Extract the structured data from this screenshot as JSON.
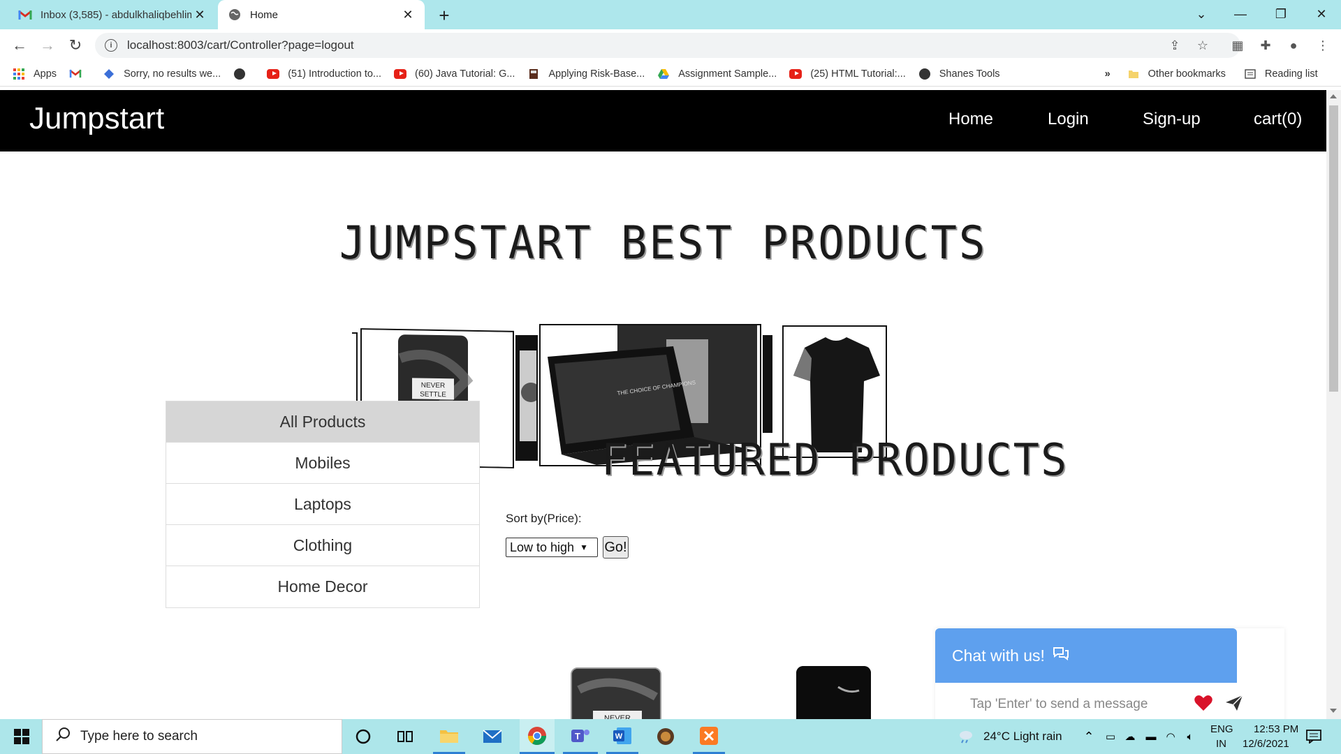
{
  "browser": {
    "tabs": [
      {
        "title": "Inbox (3,585) - abdulkhaliqbehlim",
        "active": false,
        "icon": "gmail-icon"
      },
      {
        "title": "Home",
        "active": true,
        "icon": "globe-icon"
      }
    ],
    "new_tab": "+",
    "url": "localhost:8003/cart/Controller?page=logout",
    "bookmarks": [
      {
        "label": "Apps",
        "icon": "apps-icon"
      },
      {
        "label": "",
        "icon": "gmail-icon"
      },
      {
        "label": "Sorry, no results we...",
        "icon": "diamond-icon"
      },
      {
        "label": "",
        "icon": "globe-icon"
      },
      {
        "label": "(51) Introduction to...",
        "icon": "youtube-icon"
      },
      {
        "label": "(60) Java Tutorial: G...",
        "icon": "youtube-icon"
      },
      {
        "label": "Applying Risk-Base...",
        "icon": "book-icon"
      },
      {
        "label": "Assignment Sample...",
        "icon": "drive-icon"
      },
      {
        "label": "(25) HTML Tutorial:...",
        "icon": "youtube-icon"
      },
      {
        "label": "Shanes Tools",
        "icon": "globe-icon"
      }
    ],
    "more_bookmarks": "»",
    "other_bookmarks": "Other bookmarks",
    "reading_list": "Reading list"
  },
  "site": {
    "brand": "Jumpstart",
    "nav": [
      "Home",
      "Login",
      "Sign-up",
      "cart(0)"
    ],
    "hero_title": "JUMPSTART BEST PRODUCTS",
    "categories": [
      "All Products",
      "Mobiles",
      "Laptops",
      "Clothing",
      "Home Decor"
    ],
    "active_category": "All Products",
    "featured_title": "FEATURED PRODUCTS",
    "sort_label": "Sort by(Price):",
    "sort_value": "Low to high",
    "go_label": "Go!",
    "phone_text": "NEVER SETTLE",
    "laptop_text": "THE CHOICE OF CHAMPIONS",
    "chat": {
      "title": "Chat with us!",
      "placeholder": "Tap 'Enter' to send a message"
    }
  },
  "taskbar": {
    "search_placeholder": "Type here to search",
    "weather": "24°C  Light rain",
    "lang": "ENG",
    "region": "IN",
    "time": "12:53 PM",
    "date": "12/6/2021"
  },
  "colors": {
    "tabbar": "#aee7ec",
    "site_nav": "#000000",
    "chat_header": "#5ea0ee",
    "active_category_bg": "#d6d6d6"
  }
}
